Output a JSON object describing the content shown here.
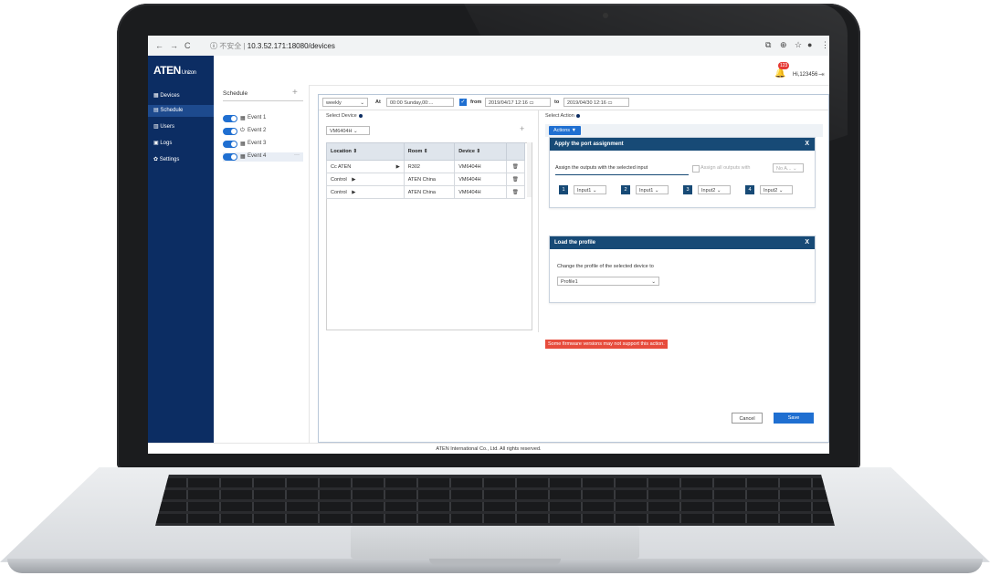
{
  "browser": {
    "url_prefix": "不安全",
    "url": "10.3.52.171:18080/devices",
    "icons": [
      "back-icon",
      "forward-icon",
      "reload-icon",
      "info-icon",
      "translate-icon",
      "zoom-icon",
      "star-icon",
      "account-icon",
      "menu-icon"
    ]
  },
  "header": {
    "brand": "ATEN",
    "brand_sub": "Unizon",
    "notification_count": "123",
    "user": "Hi,123456"
  },
  "sidebar": {
    "items": [
      {
        "label": "Devices",
        "icon": "devices-icon",
        "active": false
      },
      {
        "label": "Schedule",
        "icon": "schedule-icon",
        "active": true
      },
      {
        "label": "Users",
        "icon": "users-icon",
        "active": false
      },
      {
        "label": "Logs",
        "icon": "logs-icon",
        "active": false
      },
      {
        "label": "Settings",
        "icon": "settings-icon",
        "active": false
      }
    ]
  },
  "schedule": {
    "title": "Schedule",
    "events": [
      {
        "label": "Event 1",
        "icon": "calendar-icon"
      },
      {
        "label": "Event 2",
        "icon": "power-icon"
      },
      {
        "label": "Event 3",
        "icon": "calendar-icon"
      },
      {
        "label": "Event 4",
        "icon": "calendar-icon",
        "selected": true
      }
    ],
    "more": "···"
  },
  "filter": {
    "frequency": "weekly",
    "at_label": "At",
    "at_value": "00:00 Sunday,00:...",
    "from_label": "from",
    "from_value": "2019/04/17 12:16",
    "to_label": "to",
    "to_value": "2019/04/30 12:16"
  },
  "select_device": {
    "title": "Select Device",
    "device_filter": "VM6404H",
    "columns": [
      "Location",
      "Room",
      "Device"
    ],
    "rows": [
      {
        "location": "Cc ATEN",
        "room": "R302",
        "device": "VM6404H"
      },
      {
        "location": "Control",
        "room": "ATEN China",
        "device": "VM6404H"
      },
      {
        "location": "Control",
        "room": "ATEN China",
        "device": "VM6404H"
      }
    ]
  },
  "select_action": {
    "title": "Select Action",
    "actions_button": "Actions",
    "port_card": {
      "title": "Apply the port assignment",
      "instruction": "Assign the outputs with the selected input",
      "assign_all_label": "Assign all outputs with",
      "assign_all_value": "No A...",
      "ports": [
        {
          "num": "1",
          "input": "Input1"
        },
        {
          "num": "2",
          "input": "Input1"
        },
        {
          "num": "3",
          "input": "Input2"
        },
        {
          "num": "4",
          "input": "Input2"
        }
      ]
    },
    "profile_card": {
      "title": "Load the profile",
      "instruction": "Change the profile of the selected device to",
      "profile_value": "Profile1"
    },
    "warning": "Some firmware versions may not support this action."
  },
  "buttons": {
    "cancel": "Cancel",
    "save": "Save"
  },
  "footer": "ATEN International Co., Ltd. All rights reserved.",
  "colors": {
    "sidebar": "#0c2d63",
    "accent": "#1f6fd1",
    "card_header": "#174a76",
    "warning": "#e74c3c"
  }
}
